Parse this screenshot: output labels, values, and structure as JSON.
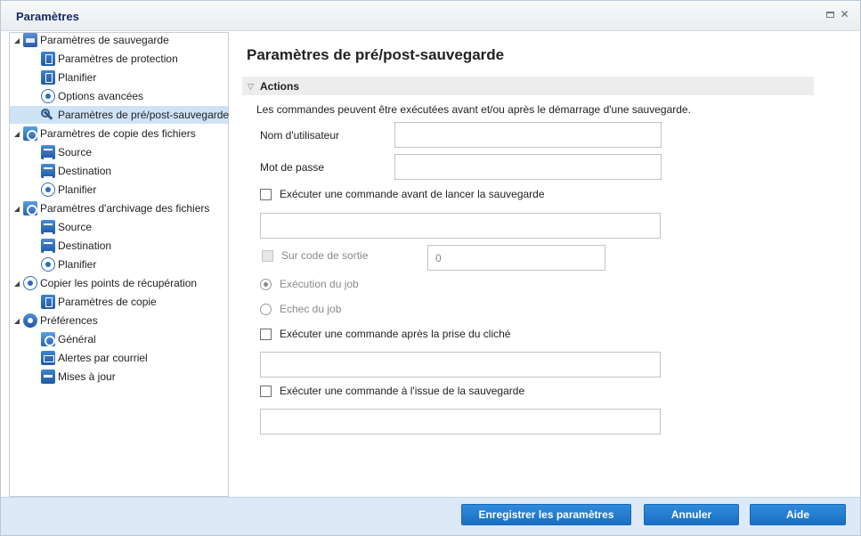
{
  "window": {
    "title": "Paramètres"
  },
  "sidebar": {
    "items": [
      {
        "label": "Paramètres de sauvegarde",
        "icon": "backup-settings-icon",
        "level": 0,
        "expanded": true
      },
      {
        "label": "Paramètres de protection",
        "icon": "protection-doc-icon",
        "level": 1
      },
      {
        "label": "Planifier",
        "icon": "schedule-icon",
        "level": 1
      },
      {
        "label": "Options avancées",
        "icon": "advanced-options-icon",
        "level": 1
      },
      {
        "label": "Paramètres de pré/post-sauvegarde",
        "icon": "wrench-icon",
        "level": 1,
        "selected": true
      },
      {
        "label": "Paramètres de copie des fichiers",
        "icon": "file-copy-icon",
        "level": 0,
        "expanded": true
      },
      {
        "label": "Source",
        "icon": "source-icon",
        "level": 1
      },
      {
        "label": "Destination",
        "icon": "destination-icon",
        "level": 1
      },
      {
        "label": "Planifier",
        "icon": "schedule-icon",
        "level": 1
      },
      {
        "label": "Paramètres d'archivage des fichiers",
        "icon": "file-archive-icon",
        "level": 0,
        "expanded": true
      },
      {
        "label": "Source",
        "icon": "source-icon",
        "level": 1
      },
      {
        "label": "Destination",
        "icon": "destination-icon",
        "level": 1
      },
      {
        "label": "Planifier",
        "icon": "schedule-icon",
        "level": 1
      },
      {
        "label": "Copier les points de récupération",
        "icon": "recovery-points-icon",
        "level": 0,
        "expanded": true
      },
      {
        "label": "Paramètres de copie",
        "icon": "copy-settings-icon",
        "level": 1
      },
      {
        "label": "Préférences",
        "icon": "preferences-icon",
        "level": 0,
        "expanded": true
      },
      {
        "label": "Général",
        "icon": "general-icon",
        "level": 1
      },
      {
        "label": "Alertes par courriel",
        "icon": "email-alert-icon",
        "level": 1
      },
      {
        "label": "Mises à jour",
        "icon": "updates-icon",
        "level": 1
      }
    ]
  },
  "main": {
    "title": "Paramètres de pré/post-sauvegarde",
    "section_label": "Actions",
    "description": "Les commandes peuvent être exécutées avant et/ou après le démarrage d'une sauvegarde.",
    "username_label": "Nom d'utilisateur",
    "username_value": "",
    "password_label": "Mot de passe",
    "password_value": "",
    "cmd_before_label": "Exécuter une commande avant de lancer la sauvegarde",
    "cmd_before_value": "",
    "exit_code_label": "Sur code de sortie",
    "exit_code_value": "0",
    "run_job_label": "Exécution du job",
    "fail_job_label": "Echec du job",
    "cmd_after_snapshot_label": "Exécuter une commande après la prise du cliché",
    "cmd_after_snapshot_value": "",
    "cmd_after_backup_label": "Exécuter une commande à l'issue de la sauvegarde",
    "cmd_after_backup_value": ""
  },
  "footer": {
    "save_label": "Enregistrer les paramètres",
    "cancel_label": "Annuler",
    "help_label": "Aide"
  },
  "colors": {
    "accent": "#1f78cc",
    "selection": "#cfe3f7",
    "footer_bg": "#dde9f6",
    "title": "#15296b"
  }
}
